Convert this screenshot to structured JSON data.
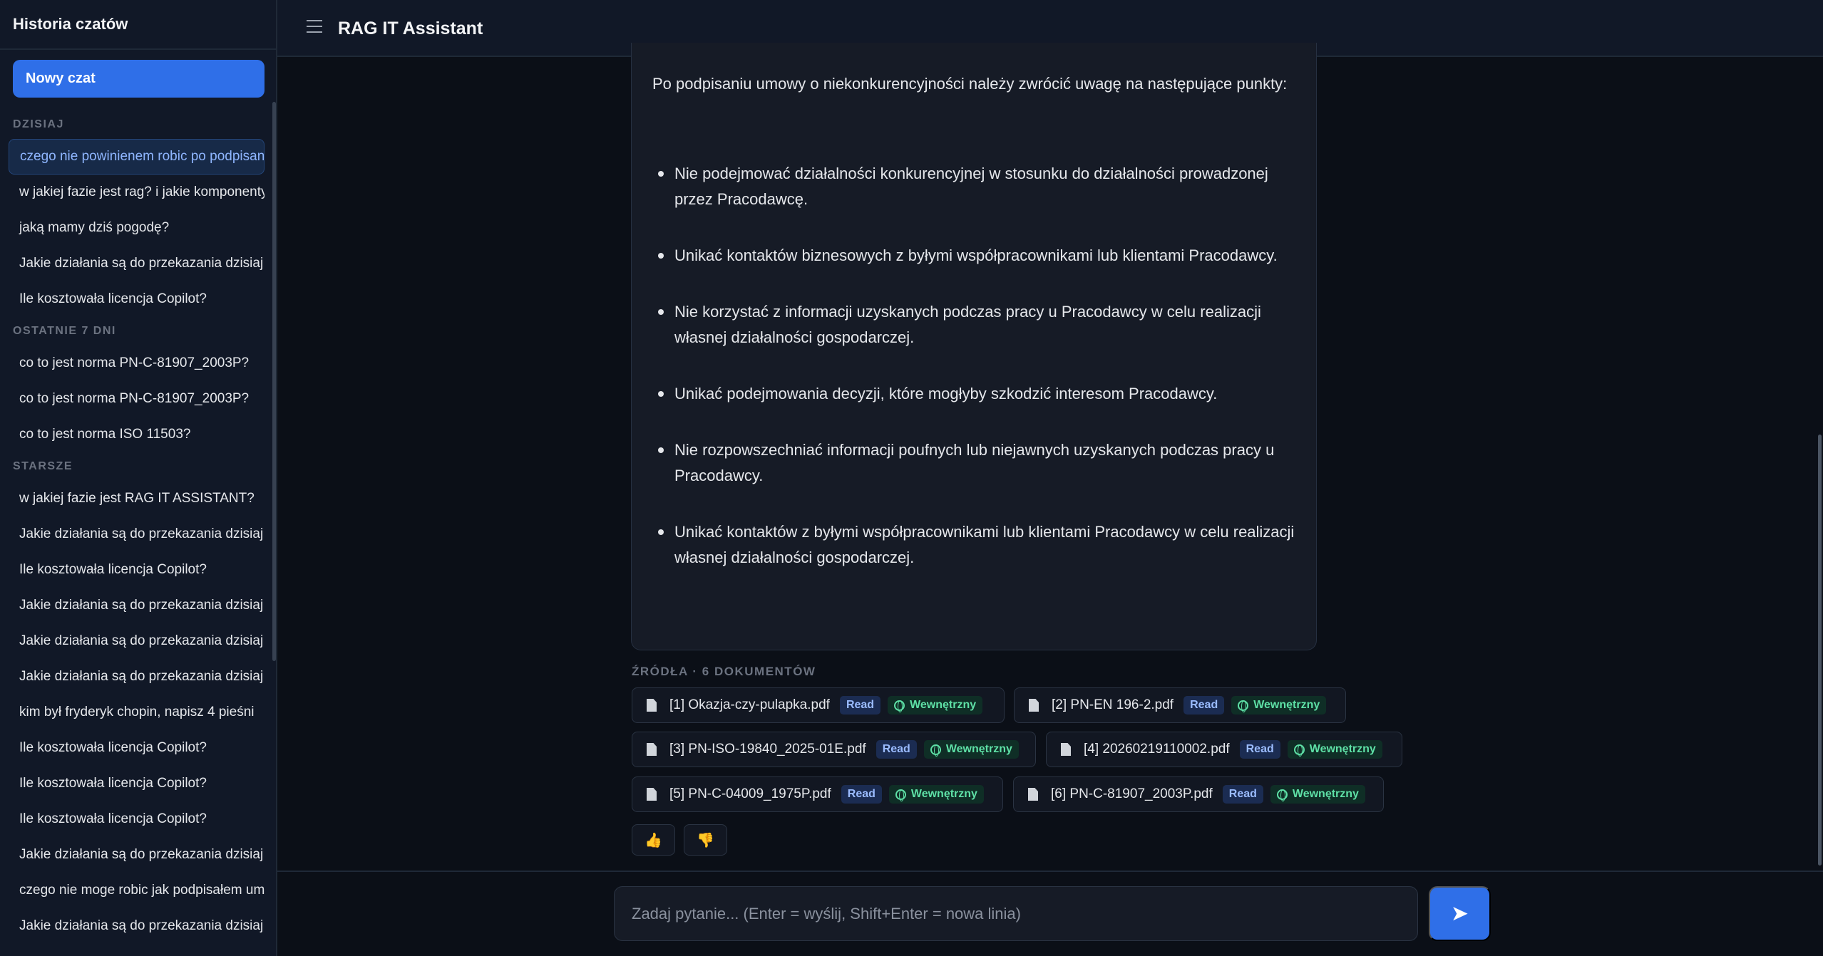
{
  "sidebar": {
    "title": "Historia czatów",
    "new_chat": "Nowy czat",
    "sections": {
      "today": "DZISIAJ",
      "last7": "OSTATNIE 7 DNI",
      "older": "STARSZE"
    },
    "today_items": [
      "czego nie powinienem robic po podpisaniu umowy",
      "w jakiej fazie jest rag? i jakie komponenty",
      "jaką mamy dziś pogodę?",
      "Jakie działania są do przekazania dzisiaj",
      "Ile kosztowała licencja Copilot?"
    ],
    "last7_items": [
      "co to jest norma PN-C-81907_2003P?",
      "co to jest norma PN-C-81907_2003P?",
      "co to jest norma ISO 11503?"
    ],
    "older_items": [
      "w jakiej fazie jest RAG IT ASSISTANT?",
      "Jakie działania są do przekazania dzisiaj",
      "Ile kosztowała licencja Copilot?",
      "Jakie działania są do przekazania dzisiaj",
      "Jakie działania są do przekazania dzisiaj",
      "Jakie działania są do przekazania dzisiaj",
      "kim był fryderyk chopin, napisz 4 pieśni",
      "Ile kosztowała licencja Copilot?",
      "Ile kosztowała licencja Copilot?",
      "Ile kosztowała licencja Copilot?",
      "Jakie działania są do przekazania dzisiaj",
      "czego nie moge robic jak podpisałem umowę",
      "Jakie działania są do przekazania dzisiaj"
    ]
  },
  "header": {
    "title": "RAG IT Assistant",
    "menu_icon": "hamburger-icon"
  },
  "message": {
    "intro": "Po podpisaniu umowy o niekonkurencyjności należy zwrócić uwagę na następujące punkty:",
    "bullets": [
      "Nie podejmować działalności konkurencyjnej w stosunku do działalności prowadzonej przez Pracodawcę.",
      "Unikać kontaktów biznesowych z byłymi współpracownikami lub klientami Pracodawcy.",
      "Nie korzystać z informacji uzyskanych podczas pracy u Pracodawcy w celu realizacji własnej działalności gospodarczej.",
      "Unikać podejmowania decyzji, które mogłyby szkodzić interesom Pracodawcy.",
      "Nie rozpowszechniać informacji poufnych lub niejawnych uzyskanych podczas pracy u Pracodawcy.",
      "Unikać kontaktów z byłymi współpracownikami lub klientami Pracodawcy w celu realizacji własnej działalności gospodarczej."
    ]
  },
  "sources": {
    "label": "ŹRÓDŁA · 6 DOKUMENTÓW",
    "items": [
      {
        "name": "[1] Okazja-czy-pulapka.pdf",
        "read": "Read",
        "scope": "Wewnętrzny"
      },
      {
        "name": "[2] PN-EN 196-2.pdf",
        "read": "Read",
        "scope": "Wewnętrzny"
      },
      {
        "name": "[3] PN-ISO-19840_2025-01E.pdf",
        "read": "Read",
        "scope": "Wewnętrzny"
      },
      {
        "name": "[4] 20260219110002.pdf",
        "read": "Read",
        "scope": "Wewnętrzny"
      },
      {
        "name": "[5] PN-C-04009_1975P.pdf",
        "read": "Read",
        "scope": "Wewnętrzny"
      },
      {
        "name": "[6] PN-C-81907_2003P.pdf",
        "read": "Read",
        "scope": "Wewnętrzny"
      }
    ]
  },
  "feedback": {
    "up": "👍",
    "down": "👎"
  },
  "input": {
    "placeholder": "Zadaj pytanie... (Enter = wyślij, Shift+Enter = nowa linia)",
    "send_icon": "send-arrow-icon",
    "send_glyph": "➤"
  },
  "colors": {
    "accent": "#2f6fe8",
    "background": "#0b0f17",
    "panel": "#111827",
    "badge_green": "#5ee0a6",
    "badge_blue": "#9bbcff"
  }
}
